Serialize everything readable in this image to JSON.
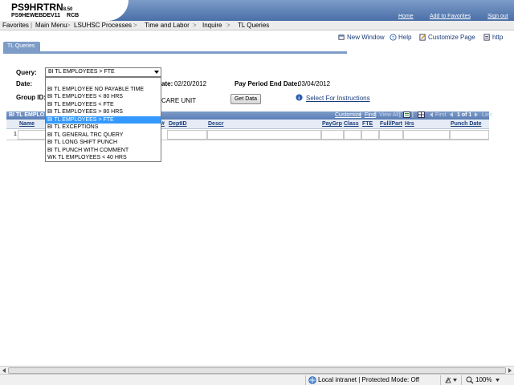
{
  "header": {
    "brand_name": "PS9HRTRN",
    "brand_version": "8.50",
    "db_name": "PS9HEWEBDEV11",
    "user_code": "RCB",
    "links": [
      "Home",
      "Add to Favorites",
      "Sign out"
    ]
  },
  "menubar": {
    "items": [
      "Favorites",
      "Main Menu",
      "LSUHSC Processes",
      "Time and Labor",
      "Inquire",
      "TL Queries"
    ],
    "separators": [
      "|",
      ">",
      ">",
      ">",
      ">"
    ]
  },
  "toolbar": {
    "new_window": "New Window",
    "help": "Help",
    "customize": "Customize Page",
    "http": "http"
  },
  "page": {
    "tab_label": "TL Queries",
    "query_label": "Query:",
    "query_value": "BI TL EMPLOYEES > FTE",
    "date_label": "Date:",
    "start_date_suffix": "ate:",
    "start_date_value": "02/20/2012",
    "period_end_label": "Pay Period End Date:",
    "period_end_value": "03/04/2012",
    "group_label": "Group ID:",
    "group_value": "CARE UNIT",
    "get_data": "Get Data",
    "instructions": "Select For Instructions"
  },
  "dropdown": {
    "options": [
      "",
      "BI TL EMPLOYEE NO PAYABLE TIME",
      "BI TL EMPLOYEES < 80 HRS",
      "BI TL EMPLOYEES < FTE",
      "BI TL EMPLOYEES > 80 HRS",
      "BI TL EMPLOYEES > FTE",
      "BI TL EXCEPTIONS",
      "BI TL GENERAL TRC QUERY",
      "BI TL LONG SHIFT PUNCH",
      "BI TL PUNCH WITH COMMENT",
      "WK TL EMPLOYEES < 40 HRS"
    ],
    "selected_index": 5
  },
  "grid": {
    "title": "BI TL EMPLO",
    "nav": {
      "customize": "Customize",
      "find": "Find",
      "view_all": "View All",
      "first": "First",
      "range": "1 of 1",
      "last": "Last",
      "sep": "|"
    },
    "columns": [
      "Name",
      "#",
      "DeptID",
      "Descr",
      "PayGrp",
      "Class",
      "FTE",
      "Full/Part",
      "Hrs",
      "Punch Date"
    ],
    "rows": [
      {
        "num": "1"
      }
    ]
  },
  "statusbar": {
    "zone": "Local intranet | Protected Mode: Off",
    "zoom": "100%"
  }
}
